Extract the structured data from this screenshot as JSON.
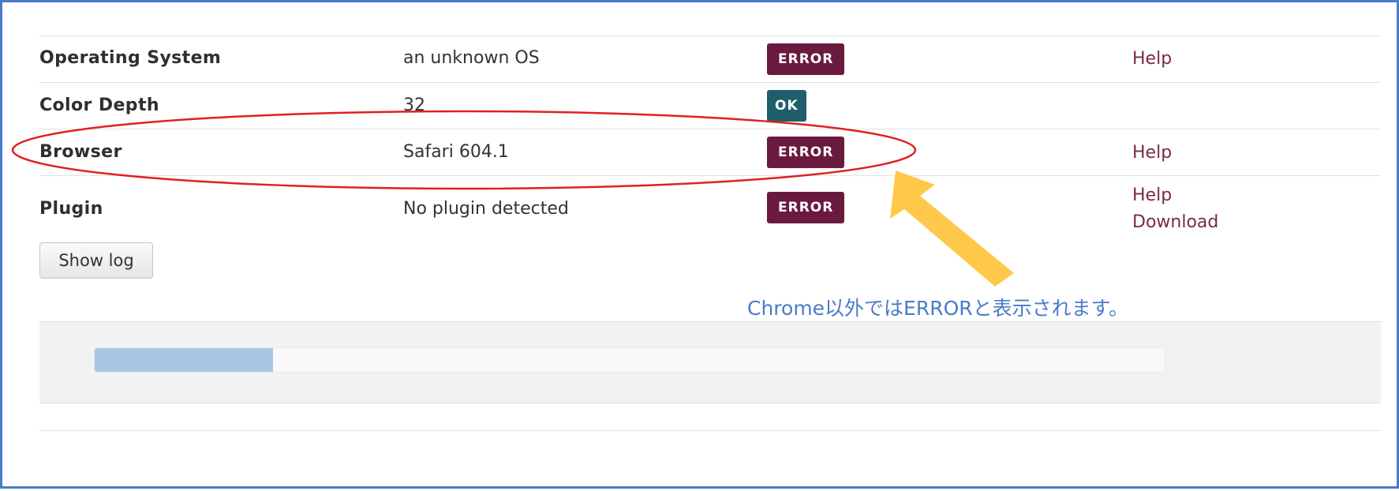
{
  "rows": [
    {
      "label": "Operating System",
      "value": "an unknown OS",
      "status": "ERROR",
      "links": [
        "Help"
      ]
    },
    {
      "label": "Color Depth",
      "value": "32",
      "status": "OK",
      "links": []
    },
    {
      "label": "Browser",
      "value": "Safari 604.1",
      "status": "ERROR",
      "links": [
        "Help"
      ]
    },
    {
      "label": "Plugin",
      "value": "No plugin detected",
      "status": "ERROR",
      "links": [
        "Help",
        "Download"
      ]
    }
  ],
  "show_log_label": "Show log",
  "progress": {
    "fraction": 0.167
  },
  "annotation": {
    "text": "Chrome以外ではERRORと表示されます。",
    "ellipse_color": "#e02020",
    "arrow_color": "#ffc84a",
    "text_color": "#4a7bc8"
  },
  "colors": {
    "error_badge": "#6b1a3f",
    "ok_badge": "#1f5f6b",
    "link": "#7a2a4a",
    "frame": "#4a7bc8"
  }
}
